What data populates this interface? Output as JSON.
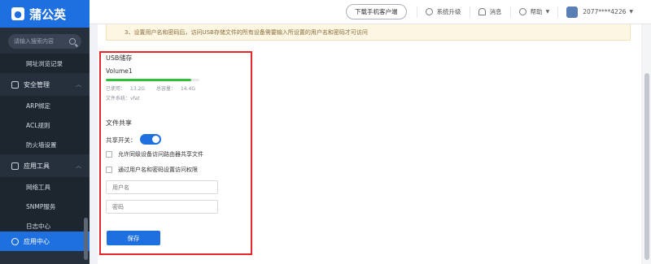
{
  "brand": {
    "name": "蒲公英",
    "logo_glyph": "●"
  },
  "sidebar": {
    "search_placeholder": "请输入搜索内容",
    "items": [
      {
        "label": "网址浏览记录",
        "type": "sub"
      },
      {
        "label": "安全管理",
        "type": "group"
      },
      {
        "label": "ARP绑定",
        "type": "sub"
      },
      {
        "label": "ACL规则",
        "type": "sub"
      },
      {
        "label": "防火墙设置",
        "type": "sub"
      },
      {
        "label": "应用工具",
        "type": "group"
      },
      {
        "label": "网络工具",
        "type": "sub"
      },
      {
        "label": "SNMP服务",
        "type": "sub"
      },
      {
        "label": "日志中心",
        "type": "sub"
      }
    ],
    "active_item": "应用中心"
  },
  "topbar": {
    "download_label": "下载手机客户端",
    "upgrade_label": "系统升级",
    "message_label": "消息",
    "help_label": "帮助",
    "account": "2077****4226"
  },
  "notice": {
    "text": "3、设置用户名和密码后，访问USB存储文件的所有设备需要输入所设置的用户名和密码才可访问"
  },
  "usb": {
    "title": "USB储存",
    "volume_name": "Volume1",
    "used_label": "已使用：",
    "used_value": "13.2G",
    "total_label": "总容量：",
    "total_value": "14.4G",
    "fs_label": "文件系统：",
    "fs_value": "vfat",
    "usage_fraction": 0.917
  },
  "file_share": {
    "title": "文件共享",
    "switch_label": "共享开关：",
    "switch_on": true,
    "option_lan": "允许同级设备访问路由器共享文件",
    "option_auth": "通过用户名和密码设置访问权限",
    "username_placeholder": "用户名",
    "password_placeholder": "密码",
    "save_label": "保存"
  },
  "colors": {
    "brand": "#1e6fe0",
    "sidebar_bg": "#26303d",
    "progress": "#2fbf38",
    "highlight_box": "#e8262a"
  }
}
